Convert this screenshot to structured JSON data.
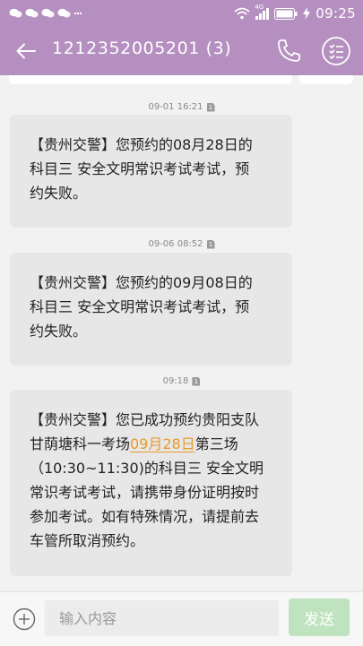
{
  "status_bar": {
    "time": "09:25",
    "signal_label": "4G",
    "left_icons": [
      "chat-bubble-icon",
      "chat-bubble-icon",
      "chat-bubble-icon",
      "chat-bubble-icon",
      "more-dots-icon"
    ]
  },
  "header": {
    "title": "1212352005201 (3)",
    "accent_color": "#b48fc0"
  },
  "messages": [
    {
      "timestamp": "09-01  16:21",
      "sim": "1",
      "lines": [
        "【贵州交警】您预约的08月28日的",
        "科目三  安全文明常识考试考试，预",
        "约失败。"
      ]
    },
    {
      "timestamp": "09-06  08:52",
      "sim": "1",
      "lines": [
        "【贵州交警】您预约的09月08日的",
        "科目三  安全文明常识考试考试，预",
        "约失败。"
      ]
    },
    {
      "timestamp": "09:18",
      "sim": "1",
      "line1": "【贵州交警】您已成功预约贵阳支队",
      "line2_before": "甘荫塘科一考场",
      "line2_link": "09月28日",
      "line2_after": "第三场",
      "lines_rest": [
        "（10:30~11:30)的科目三  安全文明",
        "常识考试考试，请携带身份证明按时",
        "参加考试。如有特殊情况，请提前去",
        "车管所取消预约。"
      ]
    }
  ],
  "input_bar": {
    "placeholder": "输入内容",
    "send_label": "发送",
    "send_color": "#bfe3bf"
  }
}
